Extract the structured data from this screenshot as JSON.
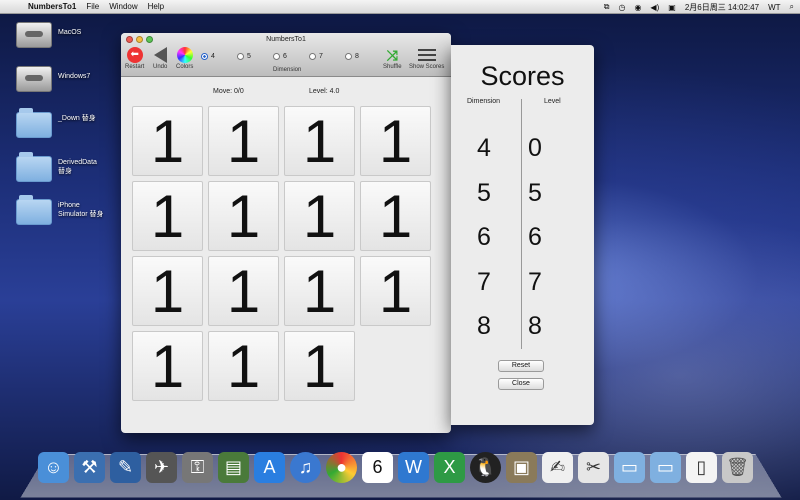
{
  "menubar": {
    "app_name": "NumbersTo1",
    "menus": [
      "File",
      "Window",
      "Help"
    ],
    "clock": "2月6日周三  14:02:47",
    "user": "WT"
  },
  "desktop": {
    "icons": [
      {
        "label": "MacOS",
        "kind": "drive"
      },
      {
        "label": "Windows7",
        "kind": "drive"
      },
      {
        "label": "_Down 替身",
        "kind": "folder"
      },
      {
        "label": "DerivedData 替身",
        "kind": "folder"
      },
      {
        "label": "iPhone Simulator 替身",
        "kind": "folder"
      }
    ]
  },
  "window": {
    "title": "NumbersTo1",
    "toolbar": {
      "restart": "Restart",
      "undo": "Undo",
      "colors": "Colors",
      "dimension_label": "Dimension",
      "shuffle": "Shuffle",
      "show_scores": "Show Scores"
    },
    "dimension_options": [
      {
        "label": "4",
        "selected": true
      },
      {
        "label": "5",
        "selected": false
      },
      {
        "label": "6",
        "selected": false
      },
      {
        "label": "7",
        "selected": false
      },
      {
        "label": "8",
        "selected": false
      }
    ],
    "move": "Move: 0/0",
    "level": "Level: 4.0",
    "tiles": [
      "1",
      "1",
      "1",
      "1",
      "1",
      "1",
      "1",
      "1",
      "1",
      "1",
      "1",
      "1",
      "1",
      "1",
      "1"
    ]
  },
  "scores": {
    "title": "Scores",
    "col_dimension": "Dimension",
    "col_level": "Level",
    "rows": [
      {
        "dimension": "4",
        "level": "0"
      },
      {
        "dimension": "5",
        "level": "5"
      },
      {
        "dimension": "6",
        "level": "6"
      },
      {
        "dimension": "7",
        "level": "7"
      },
      {
        "dimension": "8",
        "level": "8"
      }
    ],
    "reset": "Reset",
    "close": "Close"
  },
  "dock": {
    "apps": [
      "finder-icon",
      "xcode-icon",
      "instruments-icon",
      "launchpad-icon",
      "keychain-icon",
      "preview-icon",
      "appstore-icon",
      "itunes-icon",
      "chrome-icon",
      "calendar-icon",
      "word-icon",
      "excel-icon",
      "qq-icon",
      "photos-icon",
      "textedit-icon",
      "scripts-icon",
      "downloads-folder-icon",
      "documents-folder-icon",
      "zip-icon",
      "trash-icon"
    ],
    "calendar_day": "6"
  },
  "colors": {
    "restart_red": "#ee3333",
    "radio_blue": "#2561c9",
    "shuffle_green": "#33aa33"
  }
}
